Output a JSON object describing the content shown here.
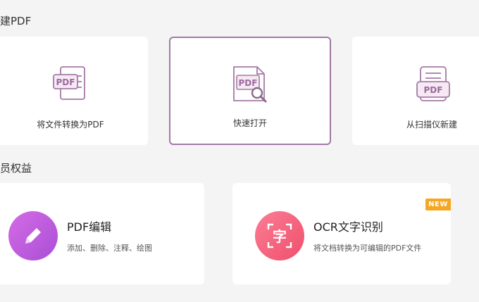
{
  "sections": {
    "create_pdf": "建PDF",
    "member_benefits": "员权益"
  },
  "create_cards": {
    "convert": {
      "label": "将文件转换为PDF",
      "icon": "pdf-convert-icon",
      "icon_text": "PDF"
    },
    "quick_open": {
      "label": "快速打开",
      "icon": "pdf-search-icon",
      "icon_text": "PDF",
      "selected": true
    },
    "scan": {
      "label": "从扫描仪新建",
      "icon": "pdf-scanner-icon",
      "icon_text": "PDF"
    }
  },
  "benefit_cards": {
    "edit": {
      "title": "PDF编辑",
      "subtitle": "添加、删除、注释、绘图",
      "icon": "pencil-icon"
    },
    "ocr": {
      "title": "OCR文字识别",
      "subtitle": "将文档转换为可编辑的PDF文件",
      "icon": "ocr-char-icon",
      "icon_char": "字",
      "badge": "NEW"
    }
  },
  "colors": {
    "accent_purple": "#a07aa3",
    "edit_gradient": [
      "#d56be6",
      "#a94fd6"
    ],
    "ocr_gradient": [
      "#fb7d95",
      "#ef4f6b"
    ],
    "badge": "#f5a623",
    "background": "#f4f4f5"
  }
}
